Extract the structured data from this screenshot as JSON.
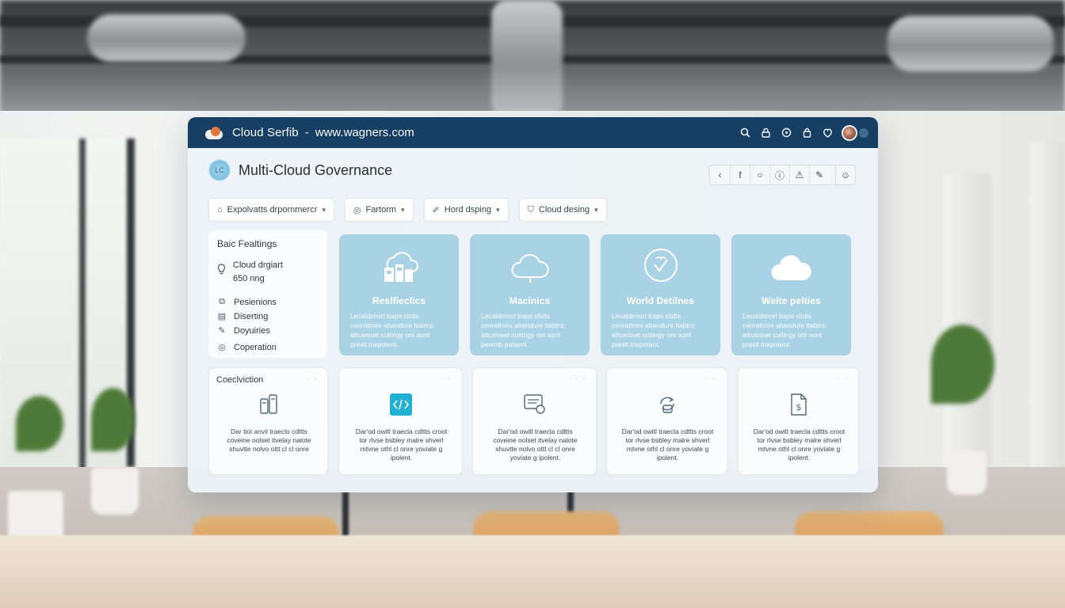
{
  "window": {
    "app_name": "Cloud Serfib",
    "separator": "-",
    "url": "www.wagners.com"
  },
  "titlebar_icons": [
    "search-icon",
    "lock-icon",
    "help-icon",
    "bag-icon",
    "notification-icon",
    "user-avatar"
  ],
  "header": {
    "title": "Multi-Cloud Governance",
    "logo_text": "LC"
  },
  "toolbar": {
    "icons": [
      "chevron-left-icon",
      "facebook-icon",
      "circle-icon",
      "info-icon",
      "alert-icon",
      "edit-icon",
      "user-icon"
    ]
  },
  "filters": [
    {
      "label": "Expolvatts drpornmercr",
      "icon": "dashboard-icon"
    },
    {
      "label": "Fartorm",
      "icon": "globe-icon"
    },
    {
      "label": "Hord dsping",
      "icon": "tag-icon"
    },
    {
      "label": "Cloud desing",
      "icon": "shield-icon"
    }
  ],
  "side_panel": {
    "title": "Baic Fealtings",
    "metric_label": "Cloud drgiart",
    "metric_value": "650 nng",
    "items": [
      {
        "label": "Pesienions",
        "icon": "box-icon"
      },
      {
        "label": "Diserting",
        "icon": "card-icon"
      },
      {
        "label": "Doyuiries",
        "icon": "pen-icon"
      },
      {
        "label": "Coperation",
        "icon": "globe-icon"
      }
    ]
  },
  "feature_cards": [
    {
      "title": "Reslfieclics",
      "icon": "cloud-buildings-icon",
      "desc": "Lecaldimorl trapo clidts cenrattnes abandure ttabtrs; altcaniset cuitingy ont aont prestl tnepotent."
    },
    {
      "title": "Macinics",
      "icon": "cloud-outline-icon",
      "desc": "Lecaldimorl trapo clidts cenrattnes abandure ttabtrs; altcaniset cuitingy ont aont pewmb patsent."
    },
    {
      "title": "World Detilnes",
      "icon": "heart-badge-icon",
      "desc": "Lecaldimorl trapo clidts cenrattnes abandure ttabtrs; altcaniset cuitingy ont aont prestl tnepotent."
    },
    {
      "title": "Welte pelties",
      "icon": "cloud-solid-icon",
      "desc": "Lecaldimorl trapo clidts cenrattnes abandure ttabtrs; altcaniset cuitingy ont aont prestl tnepotent."
    }
  ],
  "bottom_cards": [
    {
      "title": "Coeclviction",
      "icon": "server-icon",
      "desc": "Dar tiol anvil traeclo cdltts coveine oolset itvelay nalote shuvtte nolvo ottt cl cl onre"
    },
    {
      "title": "",
      "icon": "code-icon",
      "desc": "Dar'od owitl traecla cdltts croot tor rlvse bsbley malre shverl mtvne othl cl onre yoviate g ipolent."
    },
    {
      "title": "",
      "icon": "form-icon",
      "desc": "Dar'od owitl traecla cdltts coveine oolset itvelay nalote shuvtte nolvo ottt cl cl onre yoviate g ipolent."
    },
    {
      "title": "",
      "icon": "sync-icon",
      "desc": "Dar'od owitl traecla cdltts croot tor rlvse bsbley malre shverl mtvne othl cl onre yoviate g ipolent."
    },
    {
      "title": "",
      "icon": "dollar-doc-icon",
      "desc": "Dar'od owitl traecla cdltts croot tor rlvse bsbley malre shverl mtvne othl cl onre yoviate g ipolent."
    }
  ],
  "colors": {
    "titlebar": "#173e63",
    "feature_card": "#a9d3e5",
    "accent_teal": "#1fb0d4"
  }
}
